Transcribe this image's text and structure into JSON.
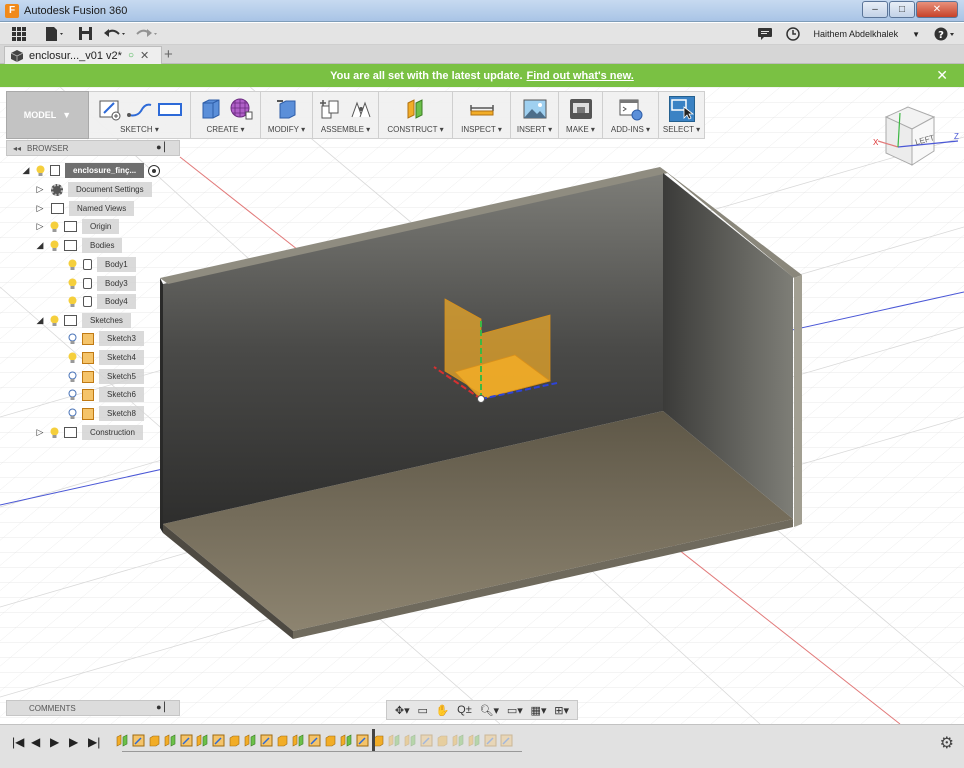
{
  "window": {
    "title": "Autodesk Fusion 360",
    "logo_letter": "F",
    "controls": {
      "minimize": "–",
      "maximize": "□",
      "close": "✕"
    }
  },
  "quick_access": {
    "user": "Haithem Abdelkhalek",
    "icons": [
      "grid-icon",
      "file-icon",
      "save-icon",
      "undo-icon",
      "redo-icon",
      "notifications-icon",
      "history-icon",
      "help-icon"
    ]
  },
  "tabs": [
    {
      "label": "enclosur..._v01 v2*",
      "close": "✕"
    }
  ],
  "tab_new": "+",
  "banner": {
    "text": "You are all set with the latest update.",
    "link": "Find out what's new.",
    "close": "✕"
  },
  "ribbon": {
    "workspace": "MODEL",
    "groups": [
      {
        "label": "SKETCH ▾"
      },
      {
        "label": "CREATE ▾"
      },
      {
        "label": "MODIFY ▾"
      },
      {
        "label": "ASSEMBLE ▾"
      },
      {
        "label": "CONSTRUCT ▾"
      },
      {
        "label": "INSPECT ▾"
      },
      {
        "label": "INSERT ▾"
      },
      {
        "label": "MAKE ▾"
      },
      {
        "label": "ADD-INS ▾"
      },
      {
        "label": "SELECT ▾"
      }
    ]
  },
  "viewcube": {
    "face": "LEFT",
    "x_label": "X",
    "z_label": "Z"
  },
  "browser": {
    "title": "BROWSER",
    "root": "enclosure_finç...",
    "items": [
      {
        "label": "Document Settings"
      },
      {
        "label": "Named Views"
      },
      {
        "label": "Origin"
      },
      {
        "label": "Bodies"
      },
      {
        "label": "Body1"
      },
      {
        "label": "Body3"
      },
      {
        "label": "Body4"
      },
      {
        "label": "Sketches"
      },
      {
        "label": "Sketch3"
      },
      {
        "label": "Sketch4"
      },
      {
        "label": "Sketch5"
      },
      {
        "label": "Sketch6"
      },
      {
        "label": "Sketch8"
      },
      {
        "label": "Construction"
      }
    ]
  },
  "comments": {
    "title": "COMMENTS"
  },
  "navbar": {
    "icons": [
      "orbit-icon",
      "look-at-icon",
      "pan-icon",
      "zoom-icon",
      "fit-icon",
      "display-settings-icon",
      "grid-settings-icon",
      "viewports-icon"
    ]
  },
  "timeline": {
    "controls": [
      "|◀",
      "◀",
      "▶",
      "▶",
      "▶|"
    ],
    "gear": "⚙"
  },
  "colors": {
    "banner": "#7ac143",
    "selected_browser_root": "#6f6f6f",
    "body_face": "#8a8370",
    "sketch_plane": "#f2ad27"
  }
}
